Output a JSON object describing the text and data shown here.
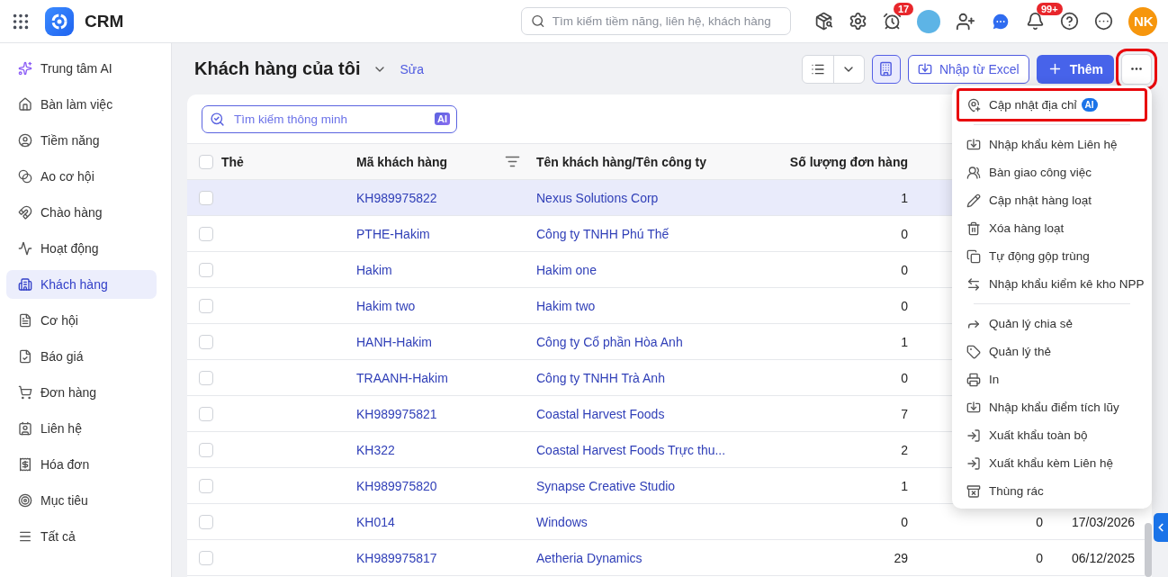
{
  "app": {
    "name": "CRM"
  },
  "search": {
    "placeholder": "Tìm kiếm tiềm năng, liên hệ, khách hàng"
  },
  "header": {
    "timer_badge": "17",
    "notifications_badge": "99+",
    "user_initials": "NK"
  },
  "sidebar": {
    "items": [
      {
        "kind": "ai",
        "label": "Trung tâm AI",
        "selected": false
      },
      {
        "kind": "home",
        "label": "Bàn làm việc",
        "selected": false
      },
      {
        "kind": "lead",
        "label": "Tiềm năng",
        "selected": false
      },
      {
        "kind": "pool",
        "label": "Ao cơ hội",
        "selected": false
      },
      {
        "kind": "magnet",
        "label": "Chào hàng",
        "selected": false
      },
      {
        "kind": "activity",
        "label": "Hoạt động",
        "selected": false
      },
      {
        "kind": "customer",
        "label": "Khách hàng",
        "selected": true
      },
      {
        "kind": "deal",
        "label": "Cơ hội",
        "selected": false
      },
      {
        "kind": "quote",
        "label": "Báo giá",
        "selected": false
      },
      {
        "kind": "order",
        "label": "Đơn hàng",
        "selected": false
      },
      {
        "kind": "contact",
        "label": "Liên hệ",
        "selected": false
      },
      {
        "kind": "invoice",
        "label": "Hóa đơn",
        "selected": false
      },
      {
        "kind": "target",
        "label": "Mục tiêu",
        "selected": false
      },
      {
        "kind": "all",
        "label": "Tất cả",
        "selected": false
      }
    ]
  },
  "page": {
    "title": "Khách hàng của tôi",
    "edit_link": "Sửa",
    "import_button": "Nhập từ Excel",
    "add_button": "Thêm",
    "more_button": {
      "highlighted": true
    }
  },
  "smart_search": {
    "placeholder": "Tìm kiếm thông minh",
    "badge": "AI"
  },
  "table": {
    "all_checked": false,
    "columns": [
      "Thẻ",
      "Mã khách hàng",
      "Tên khách hàng/Tên công ty",
      "Số lượng đơn hàng"
    ],
    "rows": [
      {
        "code": "KH989975822",
        "name": "Nexus Solutions Corp",
        "orders": "1",
        "highlighted": true
      },
      {
        "code": "PTHE-Hakim",
        "name": "Công ty TNHH Phú Thế",
        "orders": "0",
        "highlighted": false
      },
      {
        "code": "Hakim",
        "name": "Hakim one",
        "orders": "0",
        "highlighted": false
      },
      {
        "code": "Hakim two",
        "name": "Hakim two",
        "orders": "0",
        "highlighted": false
      },
      {
        "code": "HANH-Hakim",
        "name": "Công ty Cổ phần Hòa Anh",
        "orders": "1",
        "highlighted": false
      },
      {
        "code": "TRAANH-Hakim",
        "name": "Công ty TNHH Trà Anh",
        "orders": "0",
        "highlighted": false
      },
      {
        "code": "KH989975821",
        "name": "Coastal Harvest Foods",
        "orders": "7",
        "highlighted": false
      },
      {
        "code": "KH322",
        "name": "Coastal Harvest Foods Trực thu...",
        "orders": "2",
        "highlighted": false
      },
      {
        "code": "KH989975820",
        "name": "Synapse Creative Studio",
        "orders": "1",
        "highlighted": false
      },
      {
        "code": "KH014",
        "name": "Windows",
        "orders": "0",
        "column_5": "0",
        "column_6": "17/03/2026",
        "highlighted": false
      },
      {
        "code": "KH989975817",
        "name": "Aetheria Dynamics",
        "orders": "29",
        "column_5": "0",
        "column_6": "06/12/2025",
        "highlighted": false
      }
    ]
  },
  "menu": {
    "groups": [
      [
        {
          "kind": "address",
          "label": "Cập nhật địa chỉ",
          "badge": "AI",
          "highlighted": true
        }
      ],
      [
        {
          "kind": "import",
          "label": "Nhập khẩu kèm Liên hệ",
          "highlighted": false
        },
        {
          "kind": "handover",
          "label": "Bàn giao công việc",
          "highlighted": false
        },
        {
          "kind": "edit",
          "label": "Cập nhật hàng loạt",
          "highlighted": false
        },
        {
          "kind": "delete",
          "label": "Xóa hàng loạt",
          "highlighted": false
        },
        {
          "kind": "merge",
          "label": "Tự động gộp trùng",
          "highlighted": false
        },
        {
          "kind": "stock",
          "label": "Nhập khẩu kiểm kê kho NPP",
          "highlighted": false
        }
      ],
      [
        {
          "kind": "share",
          "label": "Quản lý chia sẻ",
          "highlighted": false
        },
        {
          "kind": "tag",
          "label": "Quản lý thẻ",
          "highlighted": false
        },
        {
          "kind": "print",
          "label": "In",
          "highlighted": false
        },
        {
          "kind": "import",
          "label": "Nhập khẩu điểm tích lũy",
          "highlighted": false
        },
        {
          "kind": "export",
          "label": "Xuất khẩu toàn bộ",
          "highlighted": false
        },
        {
          "kind": "export",
          "label": "Xuất khẩu kèm Liên hệ",
          "highlighted": false
        },
        {
          "kind": "bin",
          "label": "Thùng rác",
          "highlighted": false
        }
      ]
    ]
  }
}
